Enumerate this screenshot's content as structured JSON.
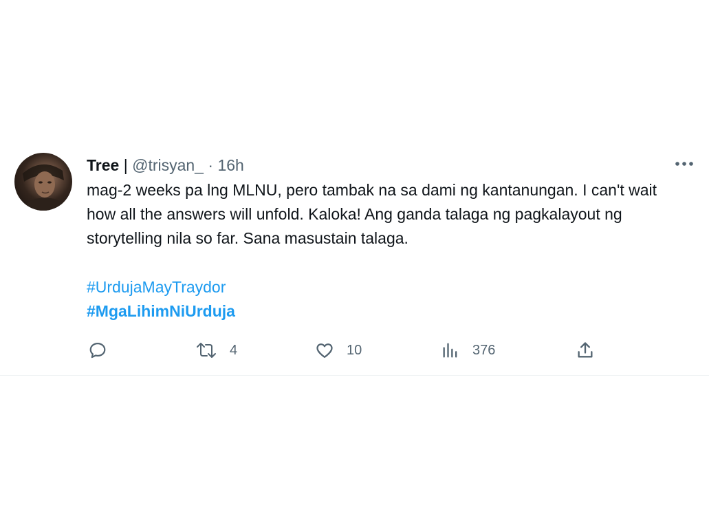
{
  "tweet": {
    "author_name": "Tree",
    "separator": "|",
    "handle": "@trisyan_",
    "dot": "·",
    "time": "16h",
    "text": "mag-2 weeks pa lng MLNU, pero tambak na sa dami ng kantanungan. I can't wait how all the answers will unfold. Kaloka! Ang ganda talaga ng pagkalayout ng storytelling nila so far. Sana masustain talaga.",
    "hashtags": [
      "#UrdujaMayTraydor",
      "#MgaLihimNiUrduja"
    ],
    "more_icon": "more-horizontal-icon"
  },
  "actions": {
    "reply": {
      "icon": "reply-icon",
      "count": ""
    },
    "retweet": {
      "icon": "retweet-icon",
      "count": "4"
    },
    "like": {
      "icon": "heart-icon",
      "count": "10"
    },
    "views": {
      "icon": "views-icon",
      "count": "376"
    },
    "share": {
      "icon": "share-icon"
    }
  },
  "colors": {
    "text": "#0f1419",
    "secondary": "#536471",
    "link": "#1d9bf0",
    "divider": "#eff3f4"
  }
}
